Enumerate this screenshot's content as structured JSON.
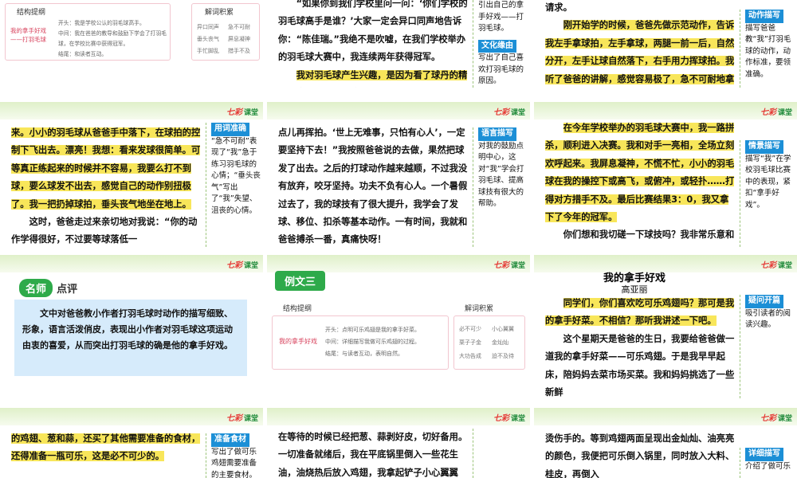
{
  "slides": [
    {
      "id": "r1c1",
      "struct_title": "结构提纲",
      "vocab_title": "解词积累",
      "struct_root": "我的拿手好戏——打羽毛球",
      "struct_items": [
        "开头：我是学校公认的羽毛球高手。",
        "中间：我在爸爸的教导和鼓励下学会了打羽毛球，在学校比赛中获得冠军。",
        "结尾：和读者互动。"
      ],
      "vocab": [
        "异口同声",
        "急不可耐",
        "垂头丧气",
        "屏息凝神",
        "手忙脚乱",
        "措手不及"
      ]
    },
    {
      "id": "r1c2",
      "text": [
        "“如果你到我们学校里问一问：‘你们学校的羽毛球高手是谁？’大家一定会异口同声地告诉你：“陈佳瑞。”我绝不是吹嘘，在我们学校举办的羽毛球大赛中，我连续两年获得冠军。",
        "我对羽毛球产生兴趣，是因为看了球丹的精彩比赛。他那标准的动作真是让人"
      ],
      "side_top": "引出自己的拿手好戏——打羽毛球。",
      "tag": "文化缘由",
      "side": "写出了自己喜欢打羽毛球的原因。"
    },
    {
      "id": "r1c3",
      "text": [
        "请求。",
        "刚开始学的时候，爸爸先做示范动作，告诉我左手拿球拍，左手拿球，两腿一前一后，自然分开，左手让球自然落下，右手用力挥球拍。我听了爸爸的讲解，感觉容易极了，急不可耐地拿起拍子，练习起"
      ],
      "tag": "动作描写",
      "side": "描写爸爸教“我”打羽毛球的动作，动作标准，要领准确。"
    },
    {
      "id": "r2c1",
      "text": [
        "来。小小的羽毛球从爸爸手中落下，在球拍的控制下飞出去。漂亮！我想：看来发球很简单。可等真正练起来的时候并不容易，我要么打不到球，要么球发不出去，感觉自己的动作别扭极了。我一把扔掉球拍，垂头丧气地坐在地上。",
        "这时，爸爸走过来亲切地对我说：“你的动作学得很好，不过要等球落低一"
      ],
      "tag": "用词准确",
      "side": "“急不可耐”表现了“我”急于练习羽毛球的心情；“垂头丧气”写出了“我”失望、沮丧的心情。"
    },
    {
      "id": "r2c2",
      "text": [
        "点儿再挥拍。‘世上无难事，只怕有心人’，一定要坚持下去！”我按照爸爸说的去做，果然把球发了出去。之后的打球动作越来越顺，不过我没有放弃，咬牙坚持。功夫不负有心人。一个暑假过去了，我的球技有了很大提升，我学会了发球、移位、扣杀等基本动作。一有时间，我就和爸爸搏杀一番，真痛快呀！"
      ],
      "tag": "语言描写",
      "side": "对我的鼓励点明中心，这对“我”学会打羽毛球、提高球技有很大的帮助。"
    },
    {
      "id": "r2c3",
      "text": [
        "在今年学校举办的羽毛球大赛中，我一路拼杀，顺利进入决赛。我和对手一亮相，全场立刻欢呼起来。我屏息凝神，不慌不忙，小小的羽毛球在我的操控下或高飞，或俯冲，或轻扑……打得对方措手不及。最后比赛结果3：0，我又拿下了今年的冠军。",
        "你们想和我切磋一下球技吗？我非常乐意和大家交流。"
      ],
      "tag": "情景描写",
      "side": "描写“我”在学校羽毛球比赛中的表现，紧扣“拿手好戏”。"
    },
    {
      "id": "r3c1",
      "heading_a": "名师",
      "heading_b": "点评",
      "text": "文中对爸爸教小作者打羽毛球时动作的描写细致、形象，语言活泼俏皮，表现出小作者对羽毛球这项运动由衷的喜爱，从而突出打羽毛球的确是他的拿手好戏。"
    },
    {
      "id": "r3c2",
      "banner": "例文三",
      "struct_title": "结构提纲",
      "vocab_title": "解词积累",
      "struct_root": "我的拿手好戏",
      "struct_items": [
        "开头：点明可乐鸡翅是我的拿手好菜。",
        "中间：详细描写我做可乐鸡翅的过程。",
        "结尾：与读者互动，表明自然。"
      ],
      "vocab": [
        "必不可少",
        "小心翼翼",
        "栗子子金",
        "金灿灿",
        "大功告成",
        "迫不及待"
      ]
    },
    {
      "id": "r3c3",
      "title": "我的拿手好戏",
      "author": "高亚丽",
      "text": [
        "同学们，你们喜欢吃可乐鸡翅吗？那可是我的拿手好菜。不相信？那听我讲述一下吧。",
        "这个星期天是爸爸的生日，我要给爸爸做一道我的拿手好菜——可乐鸡翅。于是我早早起床，陪妈妈去菜市场买菜。我和妈妈挑选了一些新鲜"
      ],
      "tag": "疑问开篇",
      "side": "吸引读者的阅读兴趣。"
    },
    {
      "id": "r4c1",
      "text": [
        "的鸡翅、葱和蒜，还买了其他需要准备的食材，还得准备一瓶可乐，这是必不可少的。"
      ],
      "tag": "准备食材",
      "side": "写出了做可乐鸡翅需要准备的主要食材。"
    },
    {
      "id": "r4c2",
      "text": [
        "在等待的时候已经把葱、蒜剥好皮，切好备用。一切准备就绪后，我在平底锅里倒入一些花生油，油烧热后放入鸡翅，我拿起铲子小心翼翼"
      ]
    },
    {
      "id": "r4c3",
      "text": [
        "烫伤手的。等到鸡翅两面呈现出金灿灿、油亮亮的颜色，我便把可乐倒入锅里，同时放入大料、桂皮，再倒入"
      ],
      "tag": "详细描写",
      "side": "介绍了做可乐"
    }
  ],
  "logo": {
    "brand": "七彩",
    "sub": "课堂"
  }
}
